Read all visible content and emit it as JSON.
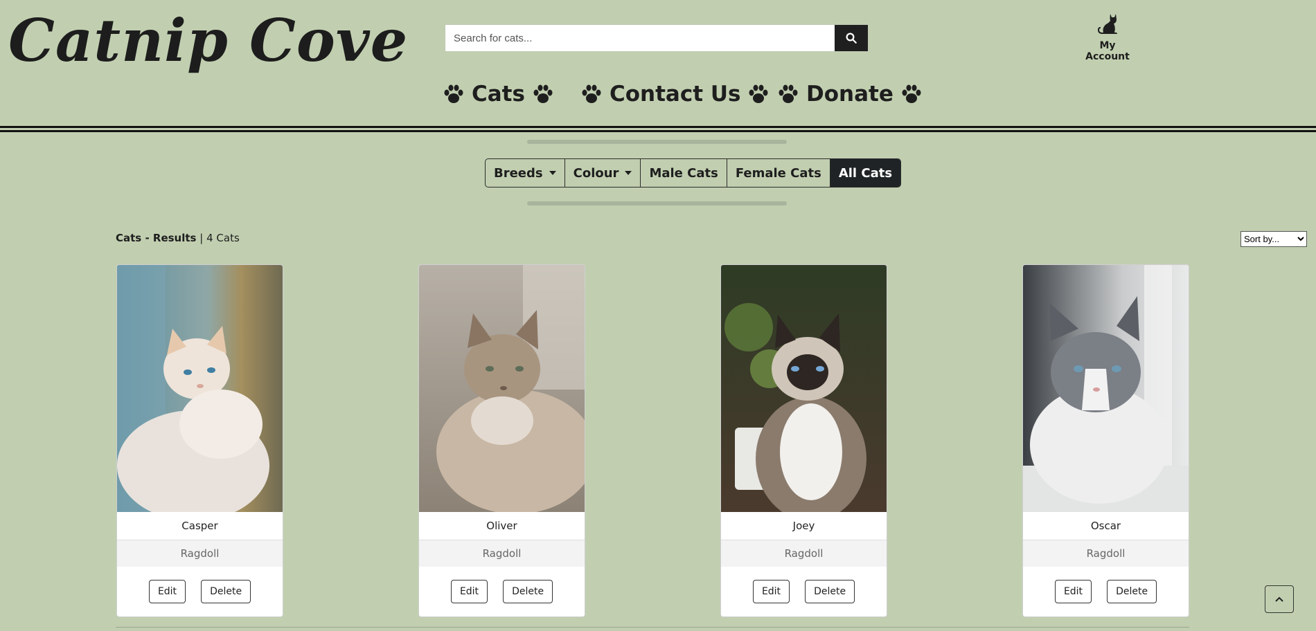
{
  "logo": "Catnip Cove",
  "search": {
    "placeholder": "Search for cats..."
  },
  "account": {
    "label": "My Account"
  },
  "nav": [
    "Cats",
    "Contact Us",
    "Donate"
  ],
  "filters": {
    "breeds": "Breeds",
    "colour": "Colour",
    "male": "Male Cats",
    "female": "Female Cats",
    "all": "All Cats"
  },
  "results": {
    "title": "Cats - Results",
    "count": "| 4 Cats"
  },
  "sort": {
    "selected": "Sort by..."
  },
  "cats": [
    {
      "name": "Casper",
      "breed": "Ragdoll"
    },
    {
      "name": "Oliver",
      "breed": "Ragdoll"
    },
    {
      "name": "Joey",
      "breed": "Ragdoll"
    },
    {
      "name": "Oscar",
      "breed": "Ragdoll"
    }
  ],
  "card_actions": {
    "edit": "Edit",
    "delete": "Delete"
  },
  "colors": {
    "background": "#c1cfb0",
    "dark": "#1f2326"
  }
}
